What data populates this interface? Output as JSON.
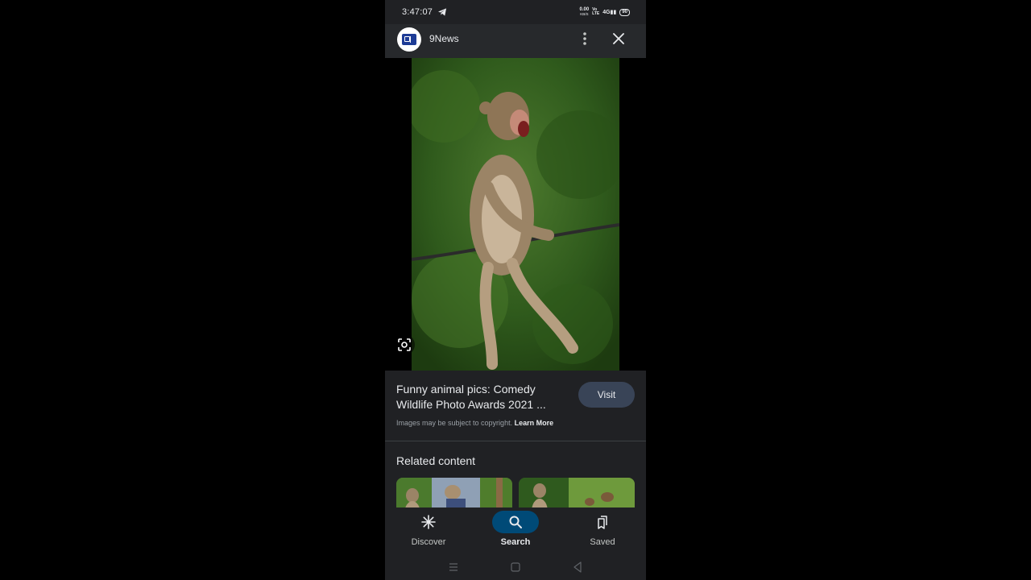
{
  "status_bar": {
    "time": "3:47:07",
    "net_speed_value": "0.00",
    "net_speed_unit": "KB/S",
    "volte_top": "Vo",
    "volte_bottom": "LTE",
    "signal": "4G",
    "battery": "90"
  },
  "header": {
    "source_name": "9News",
    "logo_icon": "9news-logo",
    "menu_icon": "more-vert-icon",
    "close_icon": "close-icon"
  },
  "image": {
    "lens_icon": "google-lens-icon"
  },
  "result": {
    "title": "Funny animal pics: Comedy Wildlife Photo Awards 2021 ...",
    "visit_label": "Visit",
    "copyright_text": "Images may be subject to copyright.",
    "learn_more_label": "Learn More"
  },
  "related": {
    "title": "Related content"
  },
  "bottom_nav": {
    "items": [
      {
        "label": "Discover",
        "icon": "asterisk-icon",
        "active": false
      },
      {
        "label": "Search",
        "icon": "search-icon",
        "active": true
      },
      {
        "label": "Saved",
        "icon": "bookmarks-icon",
        "active": false
      }
    ]
  },
  "colors": {
    "background": "#202124",
    "header": "#27292c",
    "active_pill": "#004a77",
    "visit_button": "#394457",
    "text_primary": "#e8eaed",
    "text_secondary": "#9aa0a6"
  }
}
